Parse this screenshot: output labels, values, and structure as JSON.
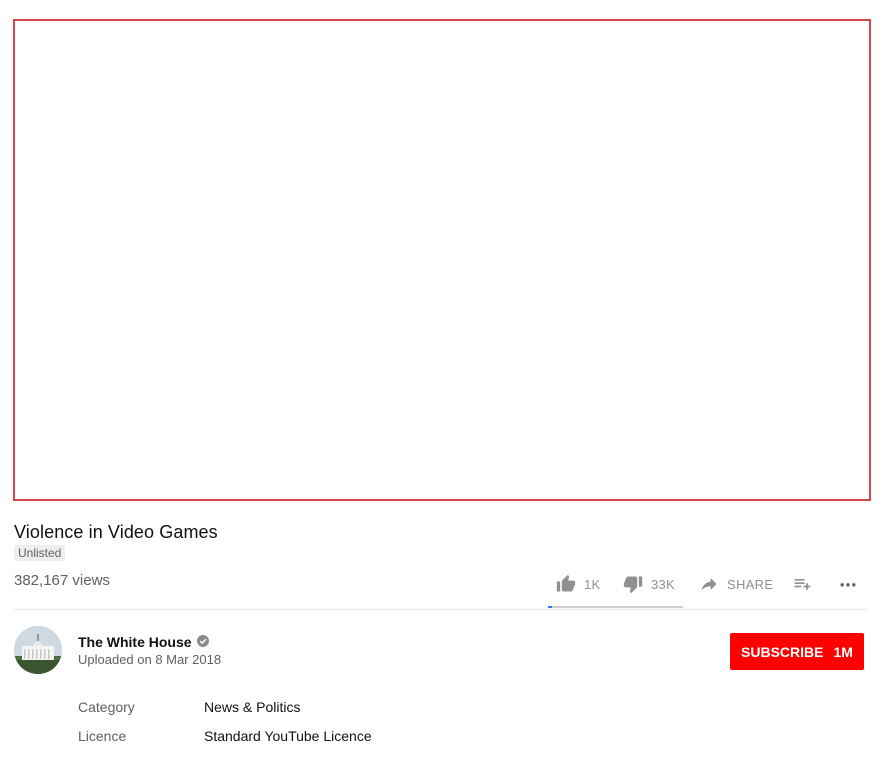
{
  "video": {
    "title": "Violence in Video Games",
    "visibility_badge": "Unlisted",
    "views": "382,167 views"
  },
  "actions": {
    "like_count": "1K",
    "dislike_count": "33K",
    "share_label": "SHARE",
    "like_ratio": 0.03
  },
  "channel": {
    "name": "The White House",
    "upload_date": "Uploaded on 8 Mar 2018",
    "subscribe_label": "SUBSCRIBE",
    "subscriber_count": "1M"
  },
  "metadata": [
    {
      "label": "Category",
      "value": "News & Politics"
    },
    {
      "label": "Licence",
      "value": "Standard YouTube Licence"
    }
  ],
  "colors": {
    "player_border": "#d84848",
    "subscribe_bg": "#ff0000",
    "like_bar": "#2f7ce6",
    "dislike_bar": "#cfcfcf"
  },
  "icons": [
    "thumb-up-icon",
    "thumb-down-icon",
    "share-icon",
    "add-to-playlist-icon",
    "more-icon",
    "verified-icon"
  ]
}
